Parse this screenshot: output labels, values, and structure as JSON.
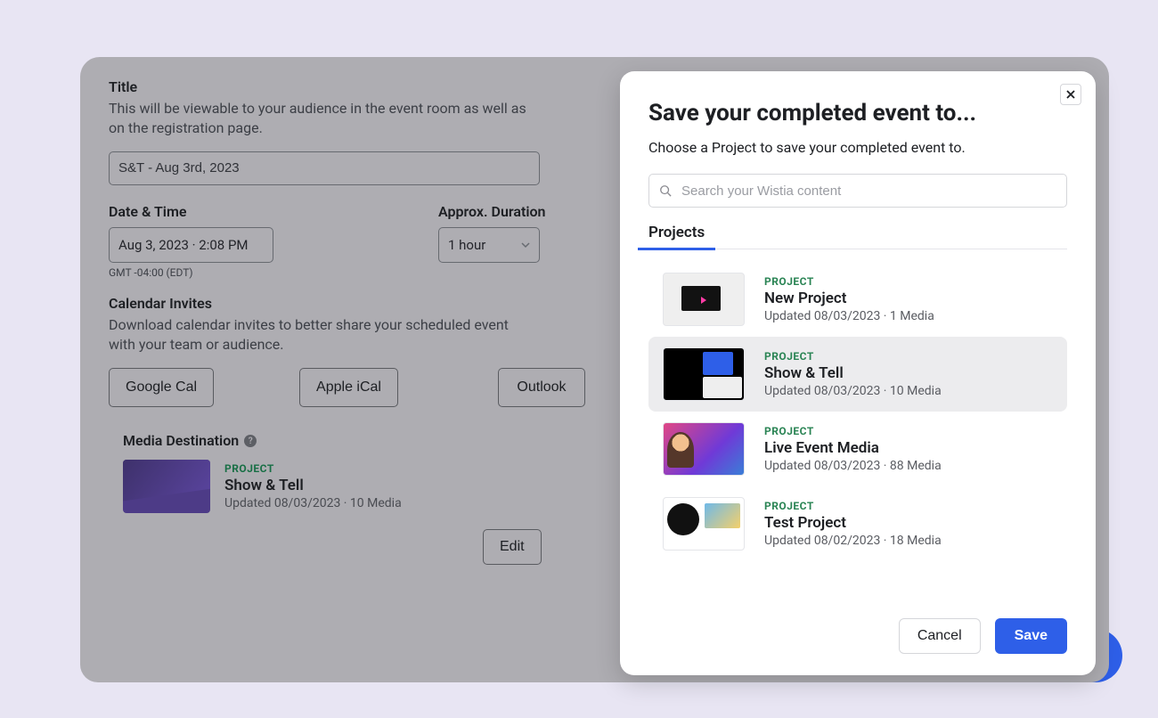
{
  "form": {
    "title_label": "Title",
    "title_desc": "This will be viewable to your audience in the event room as well as on the registration page.",
    "title_value": "S&T - Aug 3rd, 2023",
    "date_label": "Date & Time",
    "date_value": "Aug 3, 2023 · 2:08 PM",
    "tz_note": "GMT -04:00 (EDT)",
    "duration_label": "Approx. Duration",
    "duration_value": "1 hour",
    "calendar_label": "Calendar Invites",
    "calendar_desc": "Download calendar invites to better share your scheduled event with your team or audience.",
    "calendar_buttons": {
      "google": "Google Cal",
      "apple": "Apple iCal",
      "outlook": "Outlook"
    },
    "media_dest_label": "Media Destination",
    "dest_project": {
      "eyebrow": "PROJECT",
      "title": "Show & Tell",
      "sub": "Updated 08/03/2023 · 10 Media"
    },
    "edit_label": "Edit"
  },
  "modal": {
    "title": "Save your completed event to...",
    "subtitle": "Choose a Project to save your completed event to.",
    "search_placeholder": "Search your Wistia content",
    "tab_label": "Projects",
    "cancel_label": "Cancel",
    "save_label": "Save",
    "projects": [
      {
        "eyebrow": "PROJECT",
        "title": "New Project",
        "sub": "Updated 08/03/2023 · 1 Media"
      },
      {
        "eyebrow": "PROJECT",
        "title": "Show & Tell",
        "sub": "Updated 08/03/2023 · 10 Media"
      },
      {
        "eyebrow": "PROJECT",
        "title": "Live Event Media",
        "sub": "Updated 08/03/2023 · 88 Media"
      },
      {
        "eyebrow": "PROJECT",
        "title": "Test Project",
        "sub": "Updated 08/02/2023 · 18 Media"
      }
    ]
  }
}
